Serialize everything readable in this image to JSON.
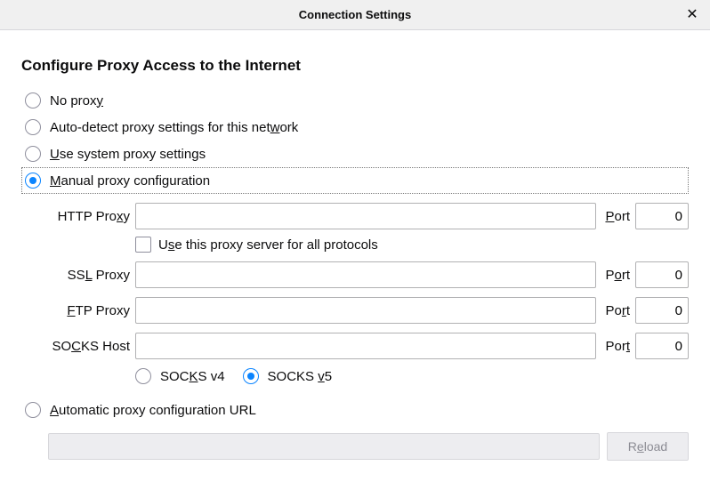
{
  "titlebar": {
    "title": "Connection Settings",
    "close_glyph": "✕"
  },
  "heading": "Configure Proxy Access to the Internet",
  "proxy_options": {
    "no_proxy_pre": "No prox",
    "no_proxy_u": "y",
    "auto_detect_pre": "Auto-detect proxy settings for this net",
    "auto_detect_u": "w",
    "auto_detect_post": "ork",
    "system_u": "U",
    "system_post": "se system proxy settings",
    "manual_u": "M",
    "manual_post": "anual proxy configuration",
    "auto_url_u": "A",
    "auto_url_post": "utomatic proxy configuration URL"
  },
  "fields": {
    "http_label_pre": "HTTP Pro",
    "http_label_u": "x",
    "http_label_post": "y",
    "http_value": "",
    "http_port_label_u": "P",
    "http_port_label_post": "ort",
    "http_port_value": "0",
    "use_all_label_pre": "U",
    "use_all_label_u": "s",
    "use_all_label_post": "e this proxy server for all protocols",
    "ssl_label_pre": "SS",
    "ssl_label_u": "L",
    "ssl_label_post": " Proxy",
    "ssl_value": "",
    "ssl_port_label_pre": "P",
    "ssl_port_label_u": "o",
    "ssl_port_label_post": "rt",
    "ssl_port_value": "0",
    "ftp_label_u": "F",
    "ftp_label_post": "TP Proxy",
    "ftp_value": "",
    "ftp_port_label_pre": "Po",
    "ftp_port_label_u": "r",
    "ftp_port_label_post": "t",
    "ftp_port_value": "0",
    "socks_label_pre": "SO",
    "socks_label_u": "C",
    "socks_label_post": "KS Host",
    "socks_value": "",
    "socks_port_label_pre": "Por",
    "socks_port_label_u": "t",
    "socks_port_value": "0",
    "socks_v4_pre": "SOC",
    "socks_v4_u": "K",
    "socks_v4_post": "S v4",
    "socks_v5_pre": "SOCKS ",
    "socks_v5_u": "v",
    "socks_v5_post": "5"
  },
  "pac": {
    "value": "",
    "reload_label_pre": "R",
    "reload_label_u": "e",
    "reload_label_post": "load"
  }
}
